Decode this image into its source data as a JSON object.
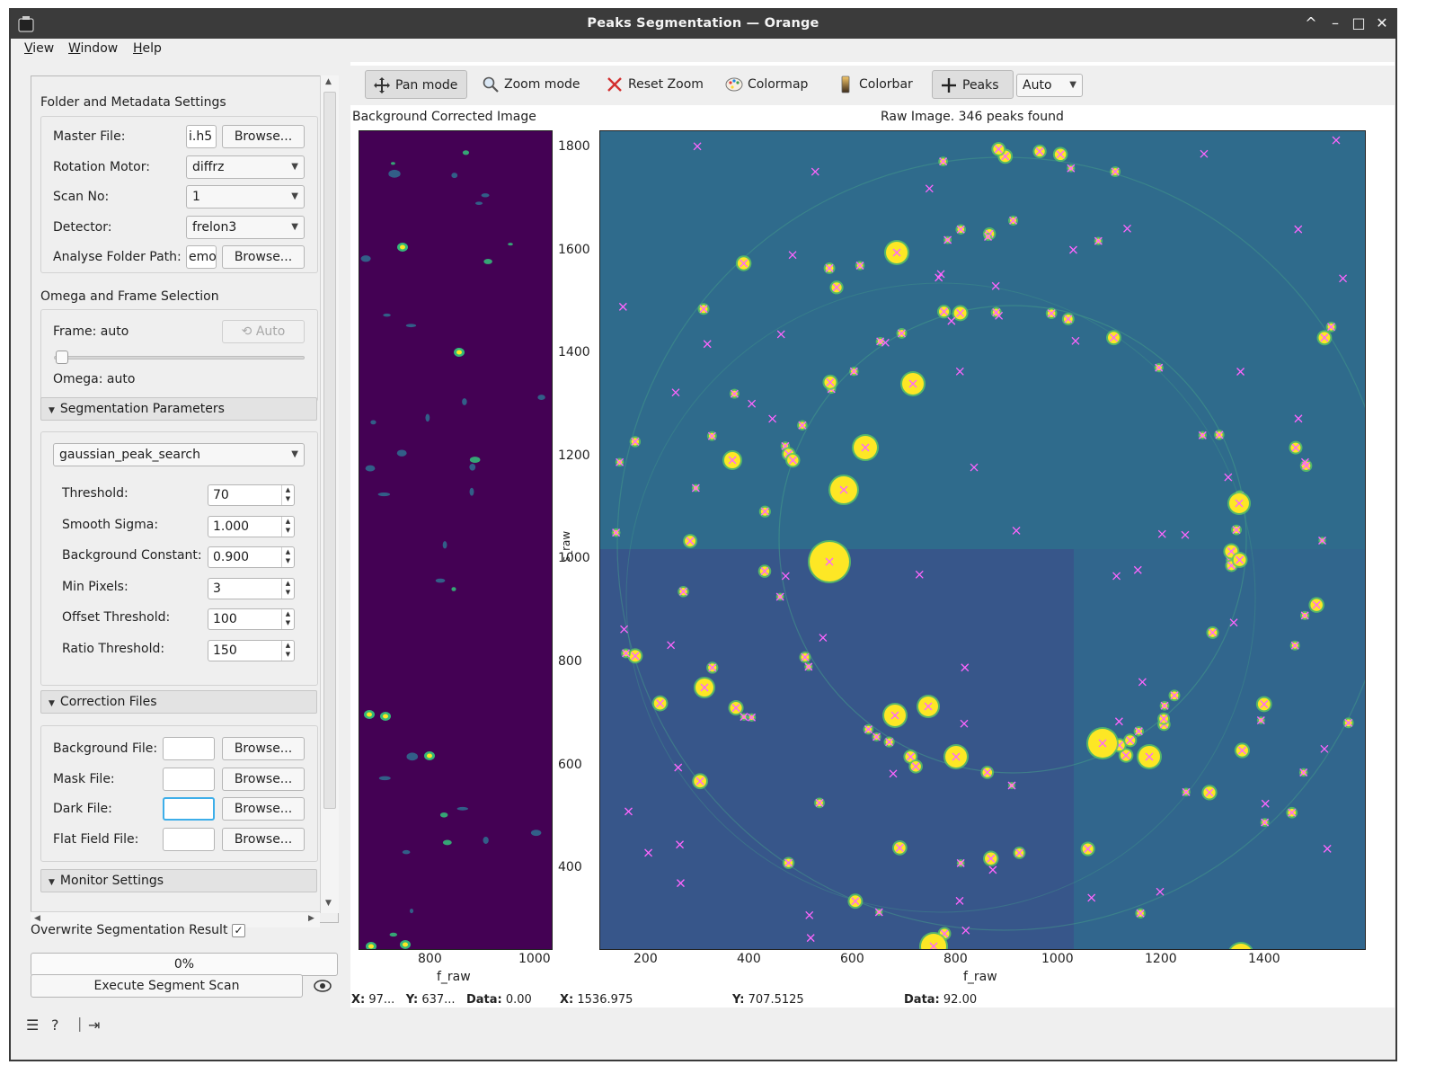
{
  "window": {
    "title": "Peaks Segmentation — Orange",
    "controls": [
      "^",
      "–",
      "□",
      "✕"
    ]
  },
  "menubar": [
    "View",
    "Window",
    "Help"
  ],
  "left_panel": {
    "folder_section": {
      "title": "Folder and Metadata Settings",
      "master_file_label": "Master File:",
      "master_file_value": "i.h5",
      "rotation_motor_label": "Rotation Motor:",
      "rotation_motor_value": "diffrz",
      "scan_no_label": "Scan No:",
      "scan_no_value": "1",
      "detector_label": "Detector:",
      "detector_value": "frelon3",
      "analyse_folder_label": "Analyse Folder Path:",
      "analyse_folder_value": "emo",
      "browse_label": "Browse..."
    },
    "omega_section": {
      "title": "Omega and Frame Selection",
      "frame_label": "Frame: auto",
      "auto_button": "Auto",
      "omega_label": "Omega: auto",
      "slider_position": 0
    },
    "segmentation": {
      "title": "Segmentation Parameters",
      "method": "gaussian_peak_search",
      "params": [
        {
          "label": "Threshold:",
          "value": "70"
        },
        {
          "label": "Smooth Sigma:",
          "value": "1.000"
        },
        {
          "label": "Background Constant:",
          "value": "0.900"
        },
        {
          "label": "Min Pixels:",
          "value": "3"
        },
        {
          "label": "Offset Threshold:",
          "value": "100"
        },
        {
          "label": "Ratio Threshold:",
          "value": "150"
        }
      ]
    },
    "correction": {
      "title": "Correction Files",
      "files": [
        {
          "label": "Background File:",
          "value": ""
        },
        {
          "label": "Mask File:",
          "value": ""
        },
        {
          "label": "Dark File:",
          "value": ""
        },
        {
          "label": "Flat Field File:",
          "value": ""
        }
      ],
      "browse_label": "Browse..."
    },
    "monitor": {
      "title": "Monitor Settings"
    },
    "overwrite_label": "Overwrite Segmentation Result",
    "overwrite_checked": "✓",
    "progress_text": "0%",
    "progress_value": 0,
    "execute_label": "Execute Segment Scan"
  },
  "toolbar": {
    "pan": "Pan mode",
    "zoom": "Zoom mode",
    "reset": "Reset Zoom",
    "colormap": "Colormap",
    "colorbar": "Colorbar",
    "peaks": "Peaks",
    "auto_select": "Auto"
  },
  "plots": {
    "left": {
      "title": "Background Corrected Image",
      "xlabel": "f_raw",
      "xticks": [
        "800",
        "1000"
      ]
    },
    "right": {
      "title": "Raw Image. 346 peaks found",
      "xlabel": "f_raw",
      "ylabel": "s_raw",
      "xticks": [
        "200",
        "400",
        "600",
        "800",
        "1000",
        "1200",
        "1400"
      ],
      "yticks": [
        "1800",
        "1600",
        "1400",
        "1200",
        "1000",
        "800",
        "600",
        "400"
      ]
    }
  },
  "status_left": {
    "x_label": "X:",
    "x_value": "97...",
    "y_label": "Y:",
    "y_value": "637...",
    "data_label": "Data:",
    "data_value": "0.00"
  },
  "status_right": {
    "x_label": "X:",
    "x_value": "1536.975",
    "y_label": "Y:",
    "y_value": "707.5125",
    "data_label": "Data:",
    "data_value": "92.00"
  },
  "colors": {
    "titlebar": "#3b3b3b",
    "viridis_dark": "#440154",
    "raw_background": "#2f6b8c",
    "peak_yellow": "#fde725",
    "marker_pink": "#ff66ff",
    "focus_blue": "#3daee9"
  }
}
